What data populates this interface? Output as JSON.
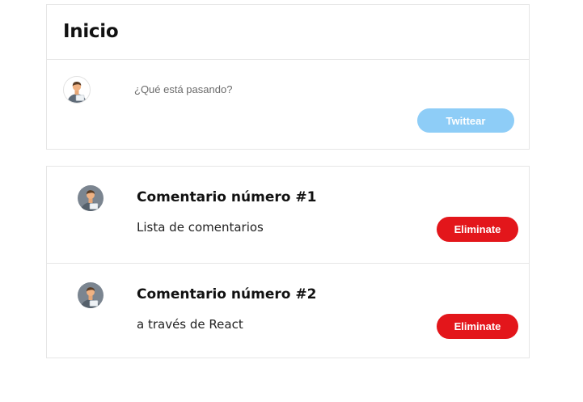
{
  "header": {
    "title": "Inicio"
  },
  "composer": {
    "avatar_icon": "user-avatar-icon",
    "placeholder": "¿Qué está pasando?",
    "value": "",
    "submit_label": "Twittear"
  },
  "comments": [
    {
      "avatar_icon": "user-avatar-icon",
      "title": "Comentario número #1",
      "body": "Lista de comentarios",
      "delete_label": "Eliminate"
    },
    {
      "avatar_icon": "user-avatar-icon",
      "title": "Comentario número #2",
      "body": "a través de React",
      "delete_label": "Eliminate"
    }
  ],
  "colors": {
    "twittear_button_bg": "#8ecdf7",
    "delete_button_bg": "#e3161b",
    "border": "#e6e6e6"
  }
}
